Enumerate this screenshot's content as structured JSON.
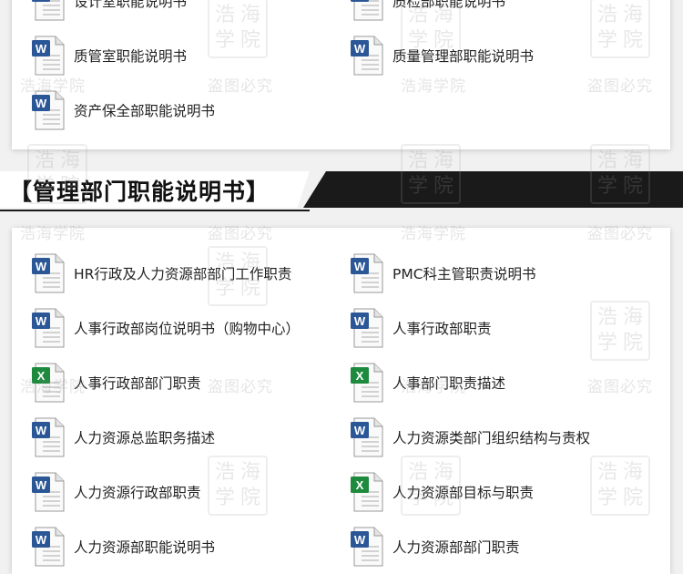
{
  "top_section": {
    "items": [
      {
        "label": "设计室职能说明书",
        "type": "word"
      },
      {
        "label": "质检部职能说明书",
        "type": "word"
      },
      {
        "label": "质管室职能说明书",
        "type": "word"
      },
      {
        "label": "质量管理部职能说明书",
        "type": "word"
      },
      {
        "label": "资产保全部职能说明书",
        "type": "word"
      }
    ]
  },
  "banner": {
    "title": "【管理部门职能说明书】"
  },
  "bottom_section": {
    "items": [
      {
        "label": "HR行政及人力资源部部门工作职责",
        "type": "word"
      },
      {
        "label": "PMC科主管职责说明书",
        "type": "word"
      },
      {
        "label": "人事行政部岗位说明书（购物中心）",
        "type": "word"
      },
      {
        "label": "人事行政部职责",
        "type": "word"
      },
      {
        "label": "人事行政部部门职责",
        "type": "excel"
      },
      {
        "label": "人事部门职责描述",
        "type": "excel"
      },
      {
        "label": "人力资源总监职务描述",
        "type": "word"
      },
      {
        "label": "人力资源类部门组织结构与责权",
        "type": "word"
      },
      {
        "label": "人力资源行政部职责",
        "type": "word"
      },
      {
        "label": "人力资源部目标与职责",
        "type": "excel"
      },
      {
        "label": "人力资源部职能说明书",
        "type": "word"
      },
      {
        "label": "人力资源部部门职责",
        "type": "word"
      }
    ]
  },
  "watermark": {
    "seal_chars": [
      "浩",
      "海",
      "学",
      "院"
    ],
    "text_left": "浩海学院",
    "text_right": "盗图必究"
  },
  "icons": {
    "word": {
      "name": "word-document-icon",
      "color": "#2b5797",
      "letter": "W"
    },
    "excel": {
      "name": "excel-document-icon",
      "color": "#1e8a3e",
      "letter": "X"
    }
  }
}
